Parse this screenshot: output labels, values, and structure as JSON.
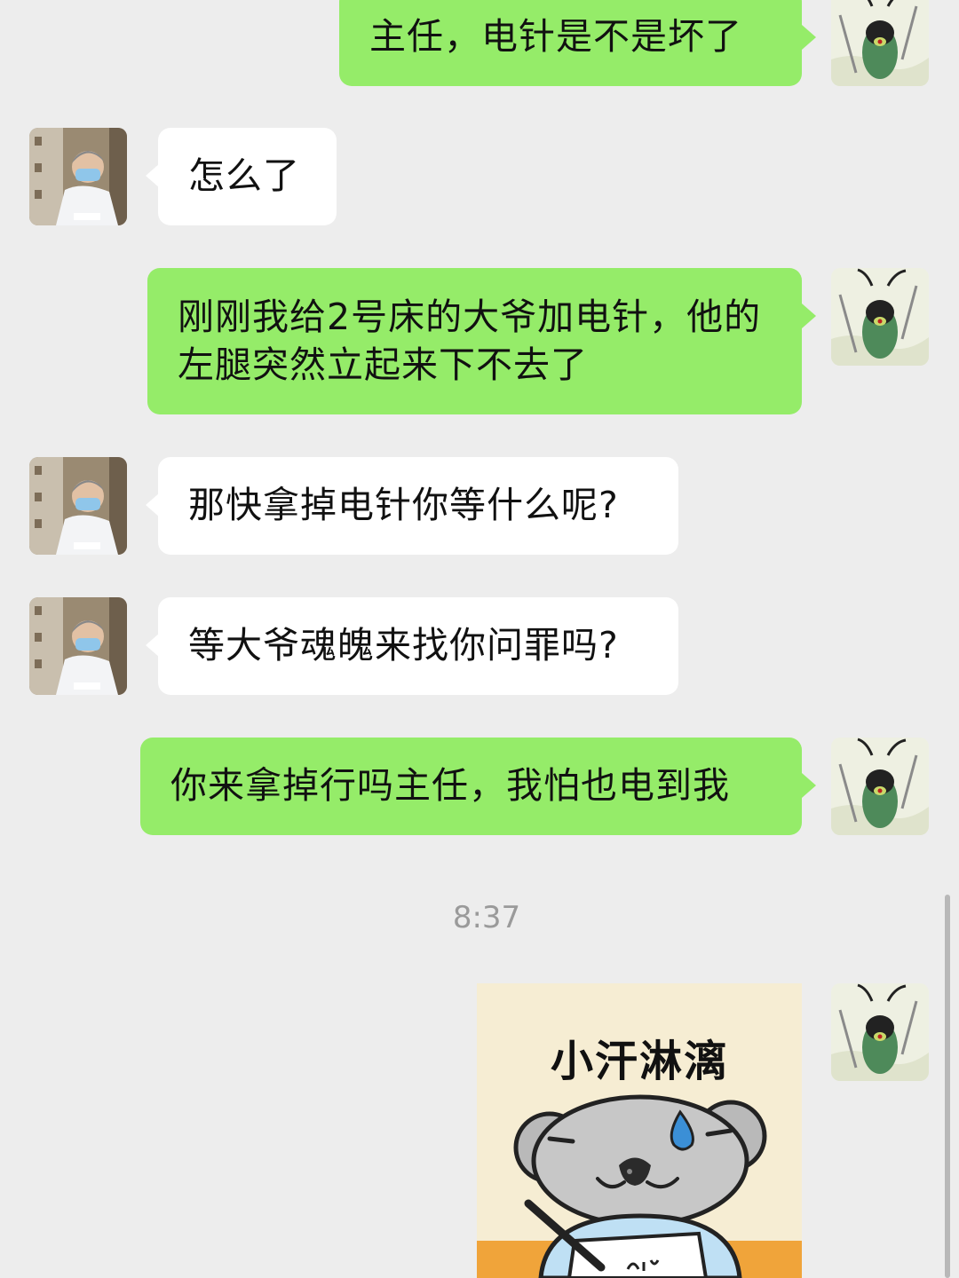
{
  "messages": [
    {
      "side": "right",
      "text": "主任，电针是不是坏了",
      "avatar": "plankton-avatar"
    },
    {
      "side": "left",
      "text": "怎么了",
      "avatar": "doctor-avatar"
    },
    {
      "side": "right",
      "text": "刚刚我给2号床的大爷加电针，他的左腿突然立起来下不去了",
      "avatar": "plankton-avatar"
    },
    {
      "side": "left",
      "text": "那快拿掉电针你等什么呢?",
      "avatar": "doctor-avatar"
    },
    {
      "side": "left",
      "text": "等大爷魂魄来找你问罪吗?",
      "avatar": "doctor-avatar"
    },
    {
      "side": "right",
      "text": "你来拿掉行吗主任，我怕也电到我",
      "avatar": "plankton-avatar"
    }
  ],
  "timestamp": "8:37",
  "sticker": {
    "caption": "小汗淋漓",
    "icon": "koala-sweat-sticker"
  },
  "colors": {
    "background": "#ededed",
    "outgoing_bubble": "#95ec69",
    "incoming_bubble": "#ffffff",
    "timestamp": "#9a9a9a"
  }
}
